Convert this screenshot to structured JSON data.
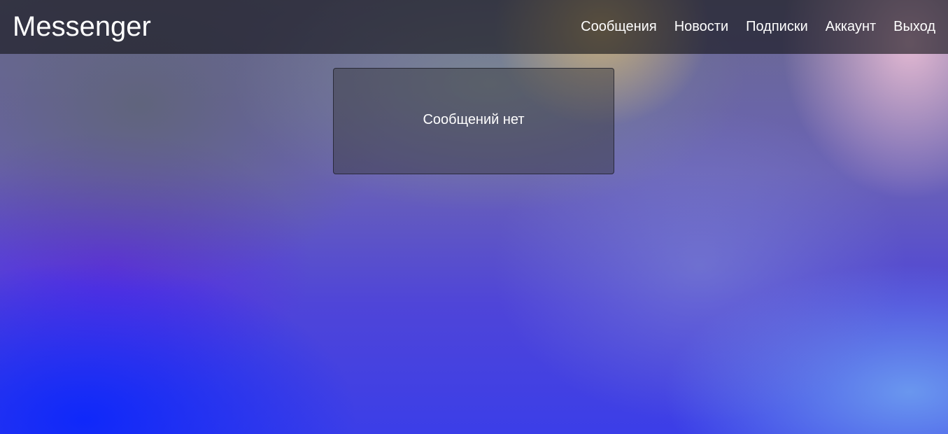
{
  "navbar": {
    "brand": "Messenger",
    "links": [
      {
        "label": "Сообщения"
      },
      {
        "label": "Новости"
      },
      {
        "label": "Подписки"
      },
      {
        "label": "Аккаунт"
      },
      {
        "label": "Выход"
      }
    ]
  },
  "main": {
    "empty_message": "Сообщений нет"
  },
  "colors": {
    "navbar_bg": "#1a1a1e",
    "text": "#ffffff"
  }
}
